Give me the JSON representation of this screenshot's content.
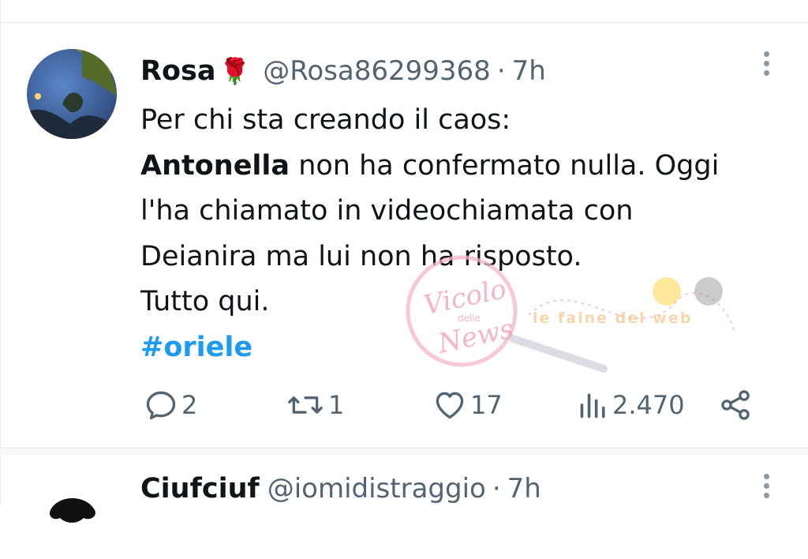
{
  "tweets": [
    {
      "name": "Rosa",
      "emoji": "🌹",
      "handle": "@Rosa86299368",
      "separator": "·",
      "time": "7h",
      "lines": {
        "line1": "Per chi sta creando il caos:",
        "bold": "Antonella",
        "line2_rest": " non ha confermato nulla. Oggi",
        "line3": "l'ha chiamato in videochiamata con",
        "line4": "Deianira ma lui non ha risposto.",
        "line5": "Tutto qui.",
        "hashtag": "#oriele"
      },
      "stats": {
        "replies": "2",
        "retweets": "1",
        "likes": "17",
        "views": "2.470"
      }
    },
    {
      "name": "Ciufciuf",
      "handle": "@iomidistraggio",
      "separator": "·",
      "time": "7h"
    }
  ],
  "watermark": {
    "text1": "Vicolo",
    "text2": "delle",
    "text3": "News",
    "text4": "le faine del web"
  },
  "colors": {
    "accent": "#1d9bf0",
    "secondary_text": "#536471",
    "primary_text": "#0f1419"
  },
  "icons": [
    "reply-icon",
    "retweet-icon",
    "like-icon",
    "views-icon",
    "share-icon",
    "more-icon"
  ]
}
